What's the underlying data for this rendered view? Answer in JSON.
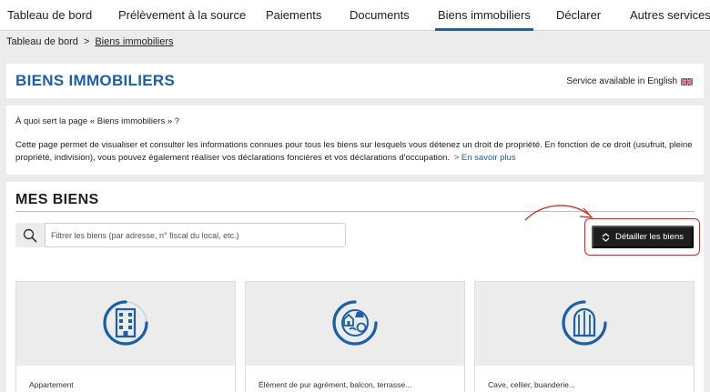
{
  "nav": {
    "items": [
      {
        "label": "Tableau de bord"
      },
      {
        "label": "Prélèvement à la source"
      },
      {
        "label": "Paiements"
      },
      {
        "label": "Documents"
      },
      {
        "label": "Biens immobiliers",
        "active": true
      },
      {
        "label": "Déclarer"
      },
      {
        "label": "Autres services"
      }
    ]
  },
  "breadcrumb": {
    "home": "Tableau de bord",
    "separator": ">",
    "current": "Biens immobiliers"
  },
  "header": {
    "title": "BIENS IMMOBILIERS",
    "lang_link": "Service available in English"
  },
  "info": {
    "question": "À quoi sert la page « Biens immobiliers » ?",
    "text": "Cette page permet de visualiser et consulter les informations connues pour tous les biens sur lesquels vous détenez un droit de propriété. En fonction de ce droit (usufruit, pleine propriété, indivision), vous pouvez également réaliser vos déclarations foncières et vos déclarations d'occupation.",
    "more_link": "> En savoir plus"
  },
  "biens": {
    "title": "MES BIENS",
    "search_placeholder": "Filtrer les biens (par adresse, n° fiscal du local, etc.)",
    "detail_button": "Détailler les biens",
    "cards": [
      {
        "label": "Appartement",
        "icon": "apartment-building-icon"
      },
      {
        "label": "Élément de pur agrément, balcon, terrasse...",
        "icon": "leisure-elements-icon"
      },
      {
        "label": "Cave, cellier, buanderie...",
        "icon": "cellar-icon"
      }
    ]
  },
  "colors": {
    "accent": "#1a5fa8",
    "highlight": "#e0231c",
    "button": "#1e1e1e"
  }
}
